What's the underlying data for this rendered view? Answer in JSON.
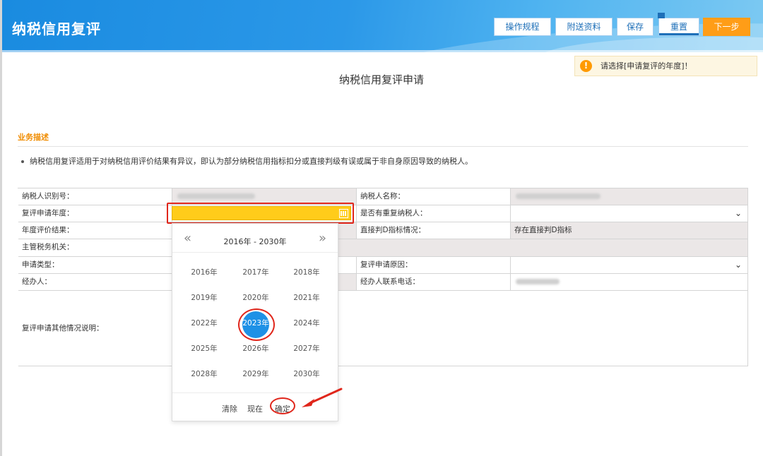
{
  "header": {
    "title": "纳税信用复评",
    "buttons": [
      {
        "label": "操作规程"
      },
      {
        "label": "附送资料"
      },
      {
        "label": "保存"
      },
      {
        "label": "重置"
      },
      {
        "label": "下一步"
      }
    ]
  },
  "notice": {
    "text": "请选择[申请复评的年度]！"
  },
  "page": {
    "title": "纳税信用复评申请"
  },
  "business": {
    "label": "业务描述",
    "description": "纳税信用复评适用于对纳税信用评价结果有异议，即认为部分纳税信用指标扣分或直接判级有误或属于非自身原因导致的纳税人。"
  },
  "form": {
    "taxpayer_id_label": "纳税人识别号：",
    "taxpayer_name_label": "纳税人名称：",
    "review_year_label": "复评申请年度：",
    "duplicate_label": "是否有重复纳税人：",
    "annual_result_label": "年度评价结果：",
    "direct_d_label": "直接判D指标情况：",
    "direct_d_value": "存在直接判D指标",
    "tax_authority_label": "主管税务机关：",
    "apply_type_label": "申请类型：",
    "review_reason_label": "复评申请原因：",
    "agent_label": "经办人：",
    "agent_phone_label": "经办人联系电话：",
    "other_notes_label": "复评申请其他情况说明："
  },
  "picker": {
    "range": "2016年 - 2030年",
    "prev": "«",
    "next": "»",
    "years": [
      "2016年",
      "2017年",
      "2018年",
      "2019年",
      "2020年",
      "2021年",
      "2022年",
      "2023年",
      "2024年",
      "2025年",
      "2026年",
      "2027年",
      "2028年",
      "2029年",
      "2030年"
    ],
    "selected": "2023年",
    "clear": "清除",
    "now": "现在",
    "confirm": "确定"
  },
  "colors": {
    "header_blue": "#1a8be0",
    "accent_orange": "#ff9d17",
    "input_yellow": "#ffcc1a",
    "selection_blue": "#1e91e6",
    "annotation_red": "#e0261b"
  }
}
